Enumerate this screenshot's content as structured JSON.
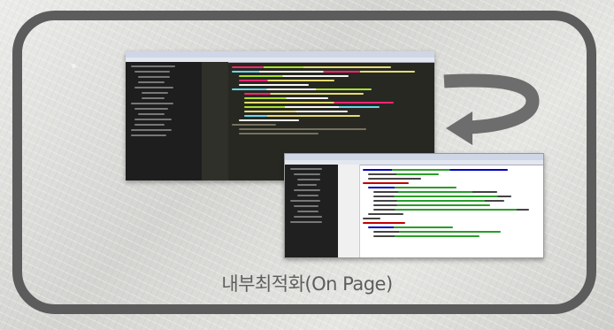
{
  "caption": "내부최적화(On Page)",
  "colors": {
    "frame": "#5c5c5c",
    "arrow": "#6d6d6d",
    "caption": "#5e5e5e",
    "dark_editor_bg": "#272822",
    "light_editor_bg": "#ffffff"
  },
  "icons": [
    "circular-arrow-icon"
  ]
}
